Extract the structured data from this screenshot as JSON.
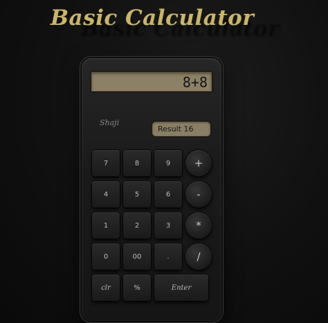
{
  "title": "Basic Calculator",
  "display": {
    "expression": "8+8"
  },
  "brand": "Shaji",
  "result": {
    "text": "Result 16"
  },
  "keys": {
    "r1": [
      "7",
      "8",
      "9"
    ],
    "r2": [
      "4",
      "5",
      "6"
    ],
    "r3": [
      "1",
      "2",
      "3"
    ],
    "r4": [
      "0",
      "00",
      "."
    ],
    "r5": [
      "clr",
      "%",
      "Enter"
    ]
  },
  "ops": [
    "+",
    "-",
    "*",
    "/"
  ],
  "colors": {
    "title": "#c9b56a",
    "display_bg": "#8c8166",
    "body_bg": "#101010"
  }
}
